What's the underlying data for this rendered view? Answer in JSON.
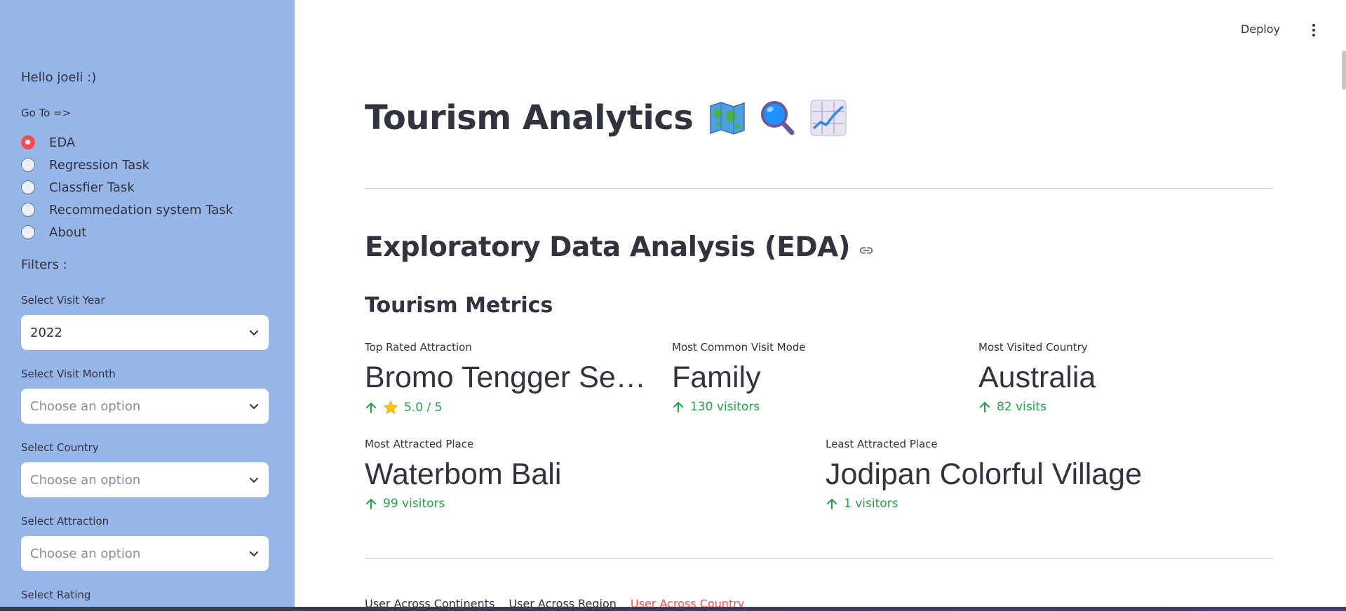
{
  "sidebar": {
    "greeting": "Hello joeli :)",
    "goto_label": "Go To =>",
    "nav_options": [
      {
        "label": "EDA",
        "selected": true
      },
      {
        "label": "Regression Task",
        "selected": false
      },
      {
        "label": "Classfier Task",
        "selected": false
      },
      {
        "label": "Recommedation system Task",
        "selected": false
      },
      {
        "label": "About",
        "selected": false
      }
    ],
    "filters_label": "Filters :",
    "filters": [
      {
        "label": "Select Visit Year",
        "value": "2022",
        "is_placeholder": false
      },
      {
        "label": "Select Visit Month",
        "value": "Choose an option",
        "is_placeholder": true
      },
      {
        "label": "Select Country",
        "value": "Choose an option",
        "is_placeholder": true
      },
      {
        "label": "Select Attraction",
        "value": "Choose an option",
        "is_placeholder": true
      },
      {
        "label": "Select Rating"
      }
    ]
  },
  "header": {
    "deploy_label": "Deploy",
    "menu_icon": "kebab-menu-icon"
  },
  "main": {
    "title": "Tourism Analytics",
    "title_icons": [
      "world-map-icon",
      "magnifying-glass-icon",
      "chart-increasing-icon"
    ],
    "section_title": "Exploratory Data Analysis (EDA)",
    "section_link_icon": "link-icon",
    "subheader": "Tourism Metrics",
    "metrics": [
      {
        "label": "Top Rated Attraction",
        "value": "Bromo Tengger Se…",
        "delta": "5.0 / 5",
        "delta_icon": "star-icon"
      },
      {
        "label": "Most Common Visit Mode",
        "value": "Family",
        "delta": "130 visitors"
      },
      {
        "label": "Most Visited Country",
        "value": "Australia",
        "delta": "82 visits"
      },
      {
        "label": "Most Attracted Place",
        "value": "Waterbom Bali",
        "delta": "99 visitors"
      },
      {
        "label": "Least Attracted Place",
        "value": "Jodipan Colorful Village",
        "delta": "1 visitors"
      }
    ],
    "tabs": [
      {
        "label": "User Across Continents",
        "active": false
      },
      {
        "label": "User Across Region",
        "active": false
      },
      {
        "label": "User Across Country",
        "active": true
      }
    ]
  },
  "colors": {
    "sidebar_bg": "#96b5e8",
    "accent": "#ff4b4b",
    "delta_green": "#21a349",
    "text": "#31333f"
  }
}
